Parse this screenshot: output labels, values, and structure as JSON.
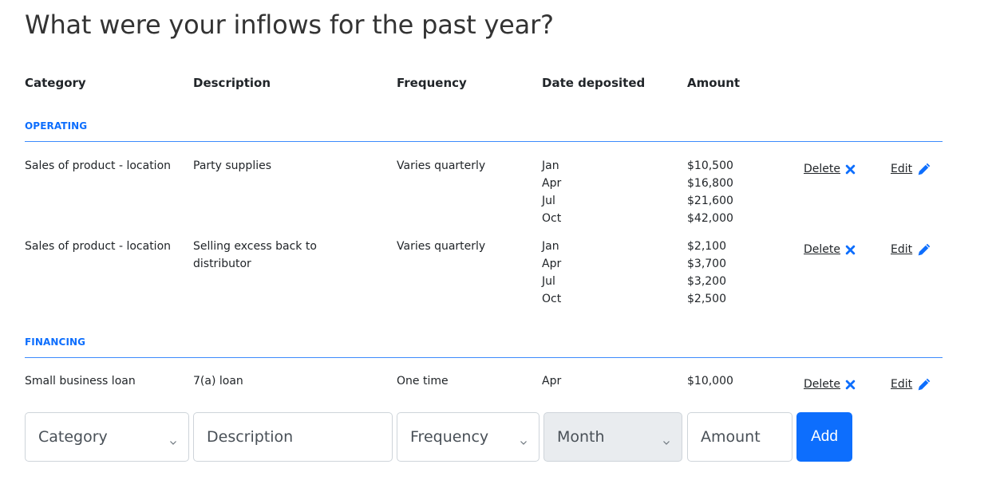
{
  "page": {
    "title": "What were your inflows for the past year?"
  },
  "table": {
    "headers": {
      "category": "Category",
      "description": "Description",
      "frequency": "Frequency",
      "date": "Date deposited",
      "amount": "Amount"
    },
    "sections": [
      {
        "label": "OPERATING",
        "rows": [
          {
            "category": "Sales of product - location",
            "description": "Party supplies",
            "frequency": "Varies quarterly",
            "dates": [
              "Jan",
              "Apr",
              "Jul",
              "Oct"
            ],
            "amounts": [
              "$10,500",
              "$16,800",
              "$21,600",
              "$42,000"
            ],
            "delete_label": "Delete",
            "edit_label": "Edit"
          },
          {
            "category": "Sales of product - location",
            "description": "Selling excess back to distributor",
            "frequency": "Varies quarterly",
            "dates": [
              "Jan",
              "Apr",
              "Jul",
              "Oct"
            ],
            "amounts": [
              "$2,100",
              "$3,700",
              "$3,200",
              "$2,500"
            ],
            "delete_label": "Delete",
            "edit_label": "Edit"
          }
        ]
      },
      {
        "label": "FINANCING",
        "rows": [
          {
            "category": "Small business loan",
            "description": "7(a) loan",
            "frequency": "One time",
            "dates": [
              "Apr"
            ],
            "amounts": [
              "$10,000"
            ],
            "delete_label": "Delete",
            "edit_label": "Edit"
          }
        ]
      }
    ]
  },
  "form": {
    "category_select": {
      "selected": "Category"
    },
    "description_input": {
      "placeholder": "Description",
      "value": ""
    },
    "frequency_select": {
      "selected": "Frequency"
    },
    "month_select": {
      "selected": "Month",
      "disabled": true
    },
    "amount_input": {
      "placeholder": "Amount",
      "value": ""
    },
    "add_label": "Add"
  },
  "icons": {
    "delete": "x-icon",
    "edit": "pencil-icon",
    "select_arrow": "chevron-down-icon"
  },
  "colors": {
    "accent": "#0d6efd",
    "section_rule": "#3d8bfd",
    "text": "#212529",
    "disabled_bg": "#e9ecef"
  }
}
